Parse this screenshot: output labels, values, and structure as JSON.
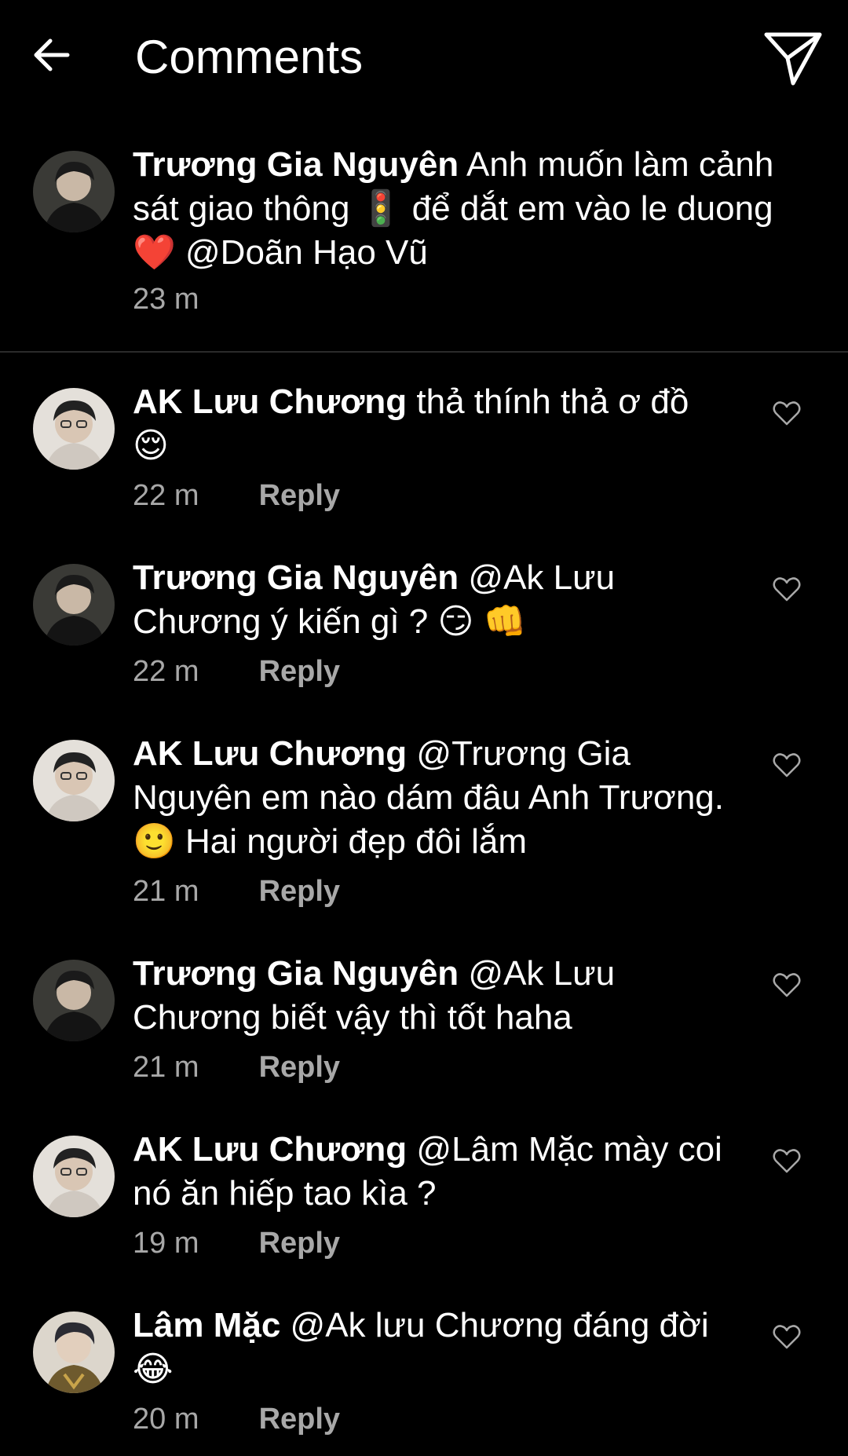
{
  "header": {
    "title": "Comments",
    "back_icon": "arrow-left-icon",
    "share_icon": "paper-plane-icon"
  },
  "caption": {
    "username": "Trương Gia Nguyên",
    "text": "Anh muốn làm cảnh sát giao thông 🚦 để dắt em vào le duong ❤️ @Doãn Hạo Vũ",
    "time": "23 m"
  },
  "reply_label": "Reply",
  "comments": [
    {
      "username": "AK Lưu Chương",
      "text": "thả thính thả ơ đồ 😌",
      "time": "22 m"
    },
    {
      "username": "Trương Gia Nguyên",
      "text": "@Ak Lưu Chương ý kiến gì ? 😏 👊",
      "time": "22 m"
    },
    {
      "username": "AK Lưu Chương",
      "text": "@Trương Gia Nguyên em nào dám đâu Anh Trương.🙂 Hai người đẹp đôi lắm",
      "time": "21 m"
    },
    {
      "username": "Trương Gia Nguyên",
      "text": "@Ak Lưu Chương biết vậy thì tốt haha",
      "time": "21 m"
    },
    {
      "username": "AK Lưu Chương",
      "text": "@Lâm Mặc mày coi nó ăn hiếp tao kìa ?",
      "time": "19 m"
    },
    {
      "username": "Lâm Mặc",
      "text": "@Ak lưu Chương đáng đời 😂",
      "time": "20 m"
    }
  ],
  "colors": {
    "background": "#000000",
    "text": "#ffffff",
    "secondary_text": "#a8a8a8",
    "divider": "#2a2a2a"
  }
}
